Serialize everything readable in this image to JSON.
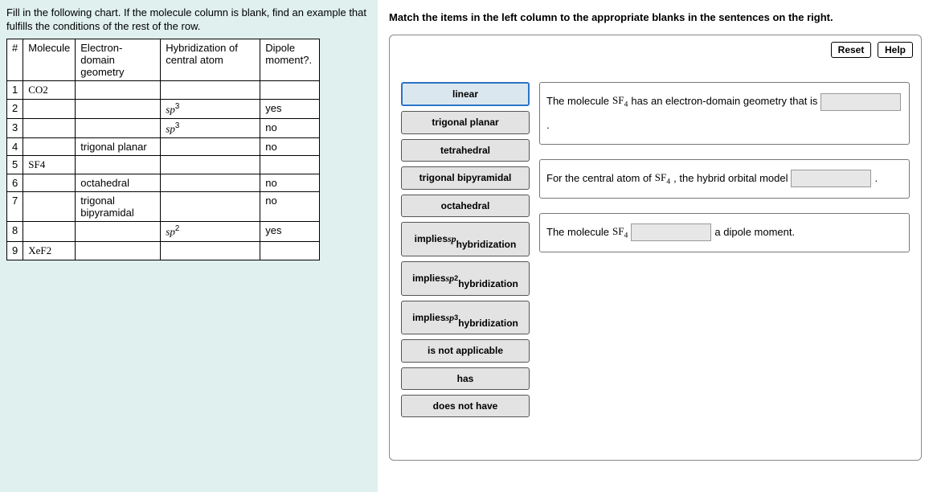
{
  "left": {
    "prompt": "Fill in the following chart. If the molecule column is blank, find an example that fulfills the conditions of the rest of the row.",
    "headers": {
      "num": "#",
      "mol": "Molecule",
      "ed": "Electron-domain geometry",
      "hyb": "Hybridization of central atom",
      "dip": "Dipole moment?."
    },
    "rows": [
      {
        "n": "1",
        "mol": "CO₂",
        "ed": "",
        "hyb": "",
        "dip": ""
      },
      {
        "n": "2",
        "mol": "",
        "ed": "",
        "hyb": "sp³",
        "dip": "yes"
      },
      {
        "n": "3",
        "mol": "",
        "ed": "",
        "hyb": "sp³",
        "dip": "no"
      },
      {
        "n": "4",
        "mol": "",
        "ed": "trigonal planar",
        "hyb": "",
        "dip": "no"
      },
      {
        "n": "5",
        "mol": "SF₄",
        "ed": "",
        "hyb": "",
        "dip": ""
      },
      {
        "n": "6",
        "mol": "",
        "ed": "octahedral",
        "hyb": "",
        "dip": "no"
      },
      {
        "n": "7",
        "mol": "",
        "ed": "trigonal bipyramidal",
        "hyb": "",
        "dip": "no"
      },
      {
        "n": "8",
        "mol": "",
        "ed": "",
        "hyb": "sp²",
        "dip": "yes"
      },
      {
        "n": "9",
        "mol": "XeF₂",
        "ed": "",
        "hyb": "",
        "dip": ""
      }
    ]
  },
  "right": {
    "title": "Match the items in the left column to the appropriate blanks in the sentences on the right.",
    "reset": "Reset",
    "help": "Help",
    "tiles": [
      {
        "label": "linear",
        "selected": true
      },
      {
        "label": "trigonal planar"
      },
      {
        "label": "tetrahedral"
      },
      {
        "label": "trigonal bipyramidal"
      },
      {
        "label": "octahedral"
      },
      {
        "label": "implies sp hybridization",
        "html": "implies <span class='serif'>sp</span><br>hybridization"
      },
      {
        "label": "implies sp2 hybridization",
        "html": "implies <span class='serif'>sp</span><sup>2</sup><br>hybridization"
      },
      {
        "label": "implies sp3 hybridization",
        "html": "implies <span class='serif'>sp</span><sup>3</sup><br>hybridization"
      },
      {
        "label": "is not applicable"
      },
      {
        "label": "has"
      },
      {
        "label": "does not have"
      }
    ],
    "sentences": {
      "s1a": "The molecule ",
      "s1b": " has an electron-domain geometry that is ",
      "s1c": " .",
      "s2a": "For the central atom of ",
      "s2b": ", the hybrid orbital model ",
      "s2c": " .",
      "s3a": "The molecule ",
      "s3b": " a dipole moment.",
      "mol": "SF₄"
    }
  }
}
